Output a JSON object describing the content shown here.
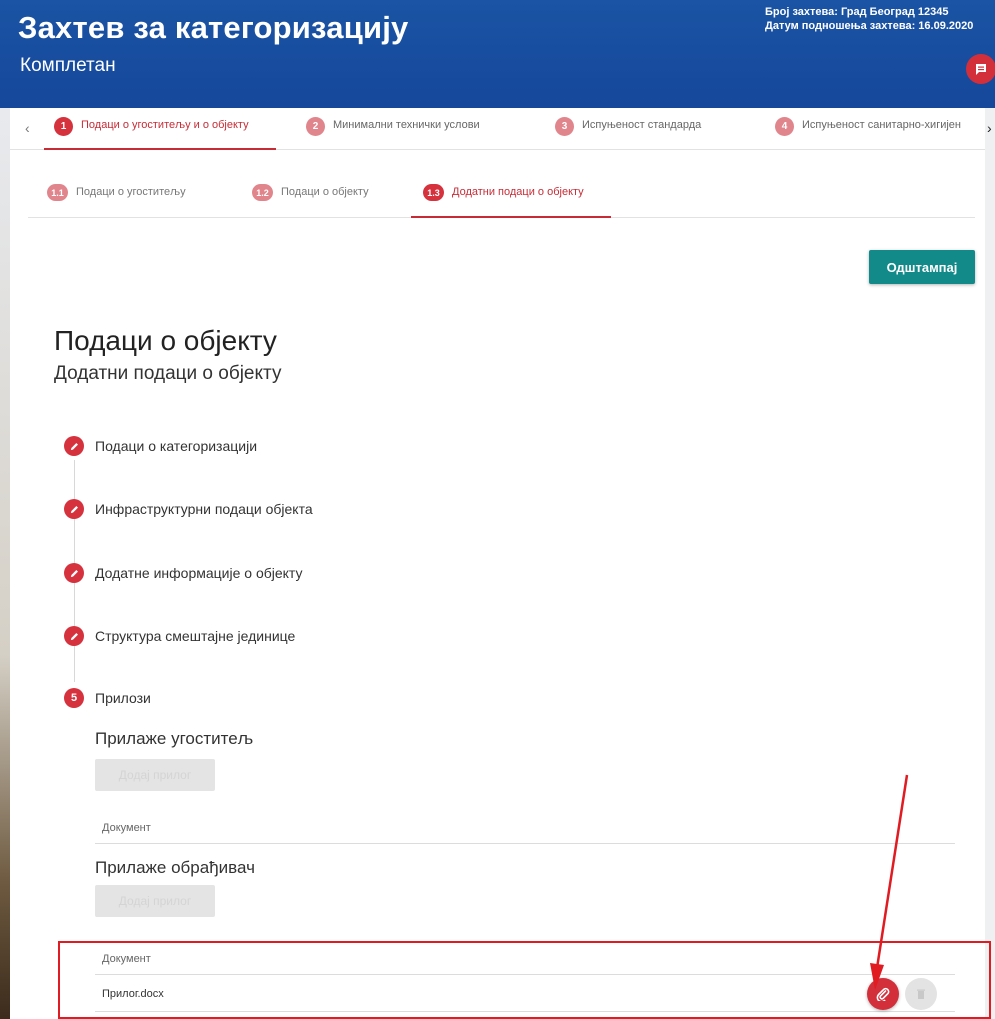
{
  "header": {
    "title": "Захтев за категоризацију",
    "subtitle": "Комплетан",
    "request_number": "Број захтева: Град Београд 12345",
    "submission_date": "Датум подношења захтева: 16.09.2020",
    "chat_icon": "chat-icon"
  },
  "steps": [
    {
      "num": "1",
      "label": "Подаци о угоститељу и о објекту",
      "active": true
    },
    {
      "num": "2",
      "label": "Минимални технички услови",
      "active": false
    },
    {
      "num": "3",
      "label": "Испуњеност стандарда",
      "active": false
    },
    {
      "num": "4",
      "label": "Испуњеност санитарно-хигијен",
      "active": false
    }
  ],
  "subtabs": [
    {
      "num": "1.1",
      "label": "Подаци о угоститељу",
      "active": false
    },
    {
      "num": "1.2",
      "label": "Подаци о објекту",
      "active": false
    },
    {
      "num": "1.3",
      "label": "Додатни подаци о објекту",
      "active": true
    }
  ],
  "print_button": "Одштампај",
  "page": {
    "title": "Подаци о објекту",
    "subtitle": "Додатни подаци о објекту"
  },
  "vertical_steps": [
    {
      "label": "Подаци о категоризацији",
      "state": "edit"
    },
    {
      "label": "Инфраструктурни подаци објекта",
      "state": "edit"
    },
    {
      "label": "Додатне информације о објекту",
      "state": "edit"
    },
    {
      "label": "Структура смештајне јединице",
      "state": "edit"
    },
    {
      "label": "Прилози",
      "state": "current",
      "num": "5"
    }
  ],
  "attachments": {
    "caterer_section": {
      "title": "Прилаже угоститељ",
      "add_button": "Додај прилог",
      "column_header": "Документ"
    },
    "processor_section": {
      "title": "Прилаже обрађивач",
      "add_button": "Додај прилог",
      "column_header": "Документ",
      "rows": [
        {
          "filename": "Прилог.docx"
        }
      ]
    }
  },
  "colors": {
    "header_blue": "#1b54a4",
    "accent_red": "#d5323d",
    "teal": "#128a8a",
    "annotation_red": "#e01b22"
  }
}
